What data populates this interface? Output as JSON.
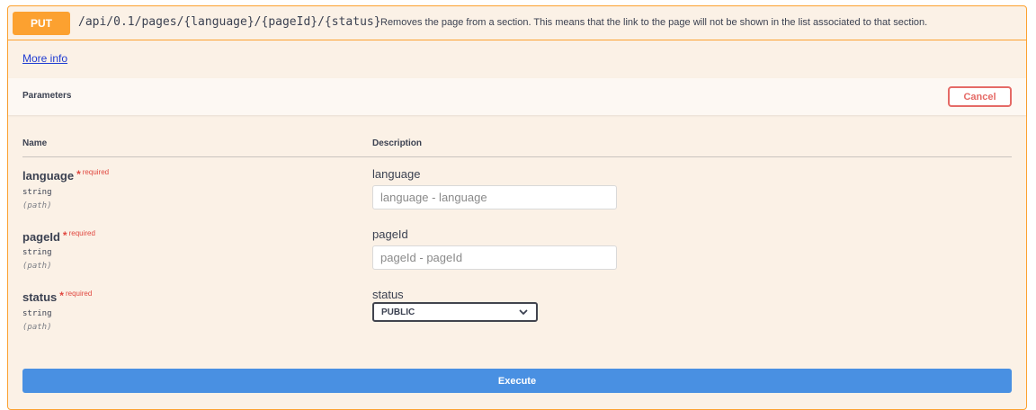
{
  "operation": {
    "method": "PUT",
    "path": "/api/0.1/pages/{language}/{pageId}/{status}",
    "summary": "Removes the page from a section. This means that the link to the page will not be shown in the list associated to that section.",
    "more_info_label": "More info"
  },
  "parameters_section": {
    "title": "Parameters",
    "cancel_label": "Cancel",
    "columns": {
      "name": "Name",
      "description": "Description"
    },
    "required_marker": "*",
    "required_label": "required",
    "params": [
      {
        "name": "language",
        "type": "string",
        "in": "(path)",
        "description": "language",
        "placeholder": "language - language"
      },
      {
        "name": "pageId",
        "type": "string",
        "in": "(path)",
        "description": "pageId",
        "placeholder": "pageId - pageId"
      },
      {
        "name": "status",
        "type": "string",
        "in": "(path)",
        "description": "status",
        "selected_value": "PUBLIC"
      }
    ]
  },
  "execute_label": "Execute",
  "colors": {
    "method_put": "#fca130",
    "block_background": "#fbf1e6",
    "cancel": "#e56a66",
    "required": "#e0473f",
    "execute": "#4990e2",
    "link": "#1f3bd1"
  },
  "icons": {
    "select_arrow": "chevron-down-icon"
  }
}
